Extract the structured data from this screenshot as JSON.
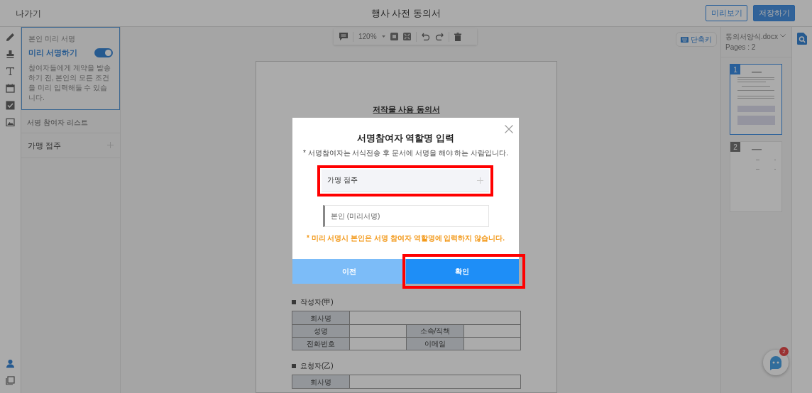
{
  "topbar": {
    "exit": "나가기",
    "title": "행사 사전 동의서",
    "buttons": [
      {
        "label": "미리보기",
        "kind": "outline"
      },
      {
        "label": "저장하기",
        "kind": "primary"
      }
    ]
  },
  "sign_panel": {
    "caption": "본인 미리 서명",
    "toggle_label": "미리 서명하기",
    "on": true,
    "description": "참여자들에게 계약을 발송하기 전, 본인의 모든 조건을 미리 입력해둘 수 있습니다.",
    "list_title": "서명 참여자 리스트",
    "participants": [
      "가맹 점주"
    ]
  },
  "toolbar": {
    "zoom": "120%"
  },
  "shortcut_button": "단축키",
  "document": {
    "title": "저작물 사용 동의서",
    "sections": [
      {
        "heading": "작성자(甲)",
        "rows": [
          [
            "회사명"
          ],
          [
            "성명",
            "소속/직책"
          ],
          [
            "전화번호",
            "이메일"
          ]
        ]
      },
      {
        "heading": "요청자(乙)",
        "rows": [
          [
            "회사명"
          ]
        ]
      }
    ]
  },
  "pages_panel": {
    "file_name": "동의서양식.docx",
    "page_count": "Pages : 2",
    "pages": [
      {
        "number": "1",
        "selected": true
      },
      {
        "number": "2",
        "selected": false
      }
    ]
  },
  "chat": {
    "badge": "2"
  },
  "modal": {
    "title": "서명참여자 역할명 입력",
    "subtitle": "* 서명참여자는 서식전송 후 문서에 서명을 해야 하는 사람입니다.",
    "roles": [
      {
        "kind": "editable",
        "value": "가맹 점주",
        "highlighted": true
      },
      {
        "kind": "fixed",
        "value": "본인 (미리서명)"
      }
    ],
    "note": "* 미리 서명시 본인은 서명 참여자 역할명에 입력하지 않습니다.",
    "buttons": [
      {
        "kind": "secondary",
        "label": "이전",
        "highlighted": false
      },
      {
        "kind": "primary",
        "label": "확인",
        "highlighted": true
      }
    ]
  }
}
